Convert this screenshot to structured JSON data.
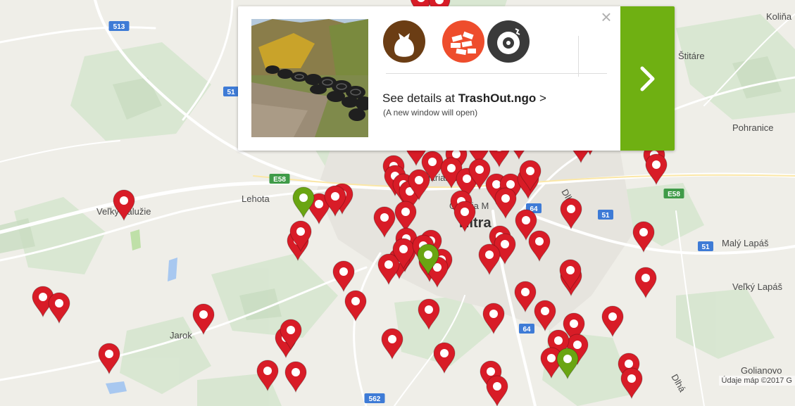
{
  "map": {
    "place_labels": [
      {
        "id": "kolina",
        "text": "Koliňa"
      },
      {
        "id": "stitare",
        "text": "Štitáre"
      },
      {
        "id": "pohranice",
        "text": "Pohranice"
      },
      {
        "id": "lehota",
        "text": "Lehota"
      },
      {
        "id": "velky-zaluzie",
        "text": "Veľký Zalužie"
      },
      {
        "id": "maly-lapas",
        "text": "Malý Lapáš"
      },
      {
        "id": "velky-lapas",
        "text": "Veľký Lapáš"
      },
      {
        "id": "jarok",
        "text": "Jarok"
      },
      {
        "id": "golianovo",
        "text": "Golianovo"
      },
      {
        "id": "nitra",
        "text": "Nitra"
      },
      {
        "id": "nitrianska",
        "text": "Nitrianska"
      },
      {
        "id": "galeria",
        "text": "Galéria M"
      },
      {
        "id": "dlha",
        "text": "Dlhá"
      },
      {
        "id": "dlha2",
        "text": "Dlhá"
      }
    ],
    "road_shields": [
      {
        "id": "r513",
        "text": "513",
        "type": "national"
      },
      {
        "id": "r51a",
        "text": "51",
        "type": "national"
      },
      {
        "id": "e58a",
        "text": "E58",
        "type": "european"
      },
      {
        "id": "e58b",
        "text": "E58",
        "type": "european"
      },
      {
        "id": "r64a",
        "text": "64",
        "type": "national"
      },
      {
        "id": "r51b",
        "text": "51",
        "type": "national"
      },
      {
        "id": "r51c",
        "text": "51",
        "type": "national"
      },
      {
        "id": "r64b",
        "text": "64",
        "type": "national"
      },
      {
        "id": "r562",
        "text": "562",
        "type": "national"
      }
    ],
    "attribution": "Údaje máp ©2017 G",
    "marker_colors": {
      "reported": "#d81c27",
      "cleaned": "#6aa512"
    },
    "markers": [
      {
        "status": "reported"
      },
      {
        "status": "reported"
      },
      {
        "status": "reported"
      },
      {
        "status": "reported"
      },
      {
        "status": "reported"
      },
      {
        "status": "reported"
      },
      {
        "status": "reported"
      },
      {
        "status": "reported"
      },
      {
        "status": "reported"
      },
      {
        "status": "reported"
      },
      {
        "status": "reported"
      },
      {
        "status": "reported"
      },
      {
        "status": "reported"
      },
      {
        "status": "reported"
      },
      {
        "status": "reported"
      },
      {
        "status": "reported"
      },
      {
        "status": "reported"
      },
      {
        "status": "reported"
      },
      {
        "status": "reported"
      },
      {
        "status": "reported"
      },
      {
        "status": "reported"
      },
      {
        "status": "reported"
      },
      {
        "status": "reported"
      },
      {
        "status": "reported"
      },
      {
        "status": "reported"
      },
      {
        "status": "reported"
      },
      {
        "status": "reported"
      },
      {
        "status": "reported"
      },
      {
        "status": "reported"
      },
      {
        "status": "reported"
      },
      {
        "status": "reported"
      },
      {
        "status": "reported"
      },
      {
        "status": "reported"
      },
      {
        "status": "reported"
      },
      {
        "status": "reported"
      },
      {
        "status": "reported"
      },
      {
        "status": "reported"
      },
      {
        "status": "reported"
      },
      {
        "status": "reported"
      },
      {
        "status": "reported"
      },
      {
        "status": "reported"
      },
      {
        "status": "reported"
      },
      {
        "status": "reported"
      },
      {
        "status": "reported"
      },
      {
        "status": "reported"
      },
      {
        "status": "reported"
      },
      {
        "status": "reported"
      },
      {
        "status": "reported"
      },
      {
        "status": "reported"
      },
      {
        "status": "reported"
      },
      {
        "status": "reported"
      },
      {
        "status": "reported"
      },
      {
        "status": "reported"
      },
      {
        "status": "reported"
      },
      {
        "status": "reported"
      },
      {
        "status": "reported"
      },
      {
        "status": "reported"
      },
      {
        "status": "reported"
      },
      {
        "status": "reported"
      },
      {
        "status": "reported"
      },
      {
        "status": "reported"
      },
      {
        "status": "reported"
      },
      {
        "status": "reported"
      },
      {
        "status": "reported"
      },
      {
        "status": "reported"
      },
      {
        "status": "reported"
      },
      {
        "status": "reported"
      },
      {
        "status": "reported"
      },
      {
        "status": "reported"
      },
      {
        "status": "reported"
      },
      {
        "status": "reported"
      },
      {
        "status": "reported"
      },
      {
        "status": "reported"
      },
      {
        "status": "reported"
      },
      {
        "status": "reported"
      },
      {
        "status": "reported"
      },
      {
        "status": "reported"
      },
      {
        "status": "reported"
      },
      {
        "status": "reported"
      },
      {
        "status": "reported"
      },
      {
        "status": "cleaned"
      },
      {
        "status": "cleaned"
      },
      {
        "status": "cleaned"
      }
    ]
  },
  "popup": {
    "categories": [
      {
        "id": "household",
        "icon": "trash-bag-icon",
        "color": "#6b3d14"
      },
      {
        "id": "construction",
        "icon": "bricks-icon",
        "color": "#ee4d2c"
      },
      {
        "id": "tires",
        "icon": "tire-icon",
        "color": "#3a3a3a"
      }
    ],
    "details_prefix": "See details at ",
    "details_link": "TrashOut.ngo",
    "details_suffix": " >",
    "note": "(A new window will open)",
    "close_label": "×",
    "go_button_color": "#6fb012"
  }
}
